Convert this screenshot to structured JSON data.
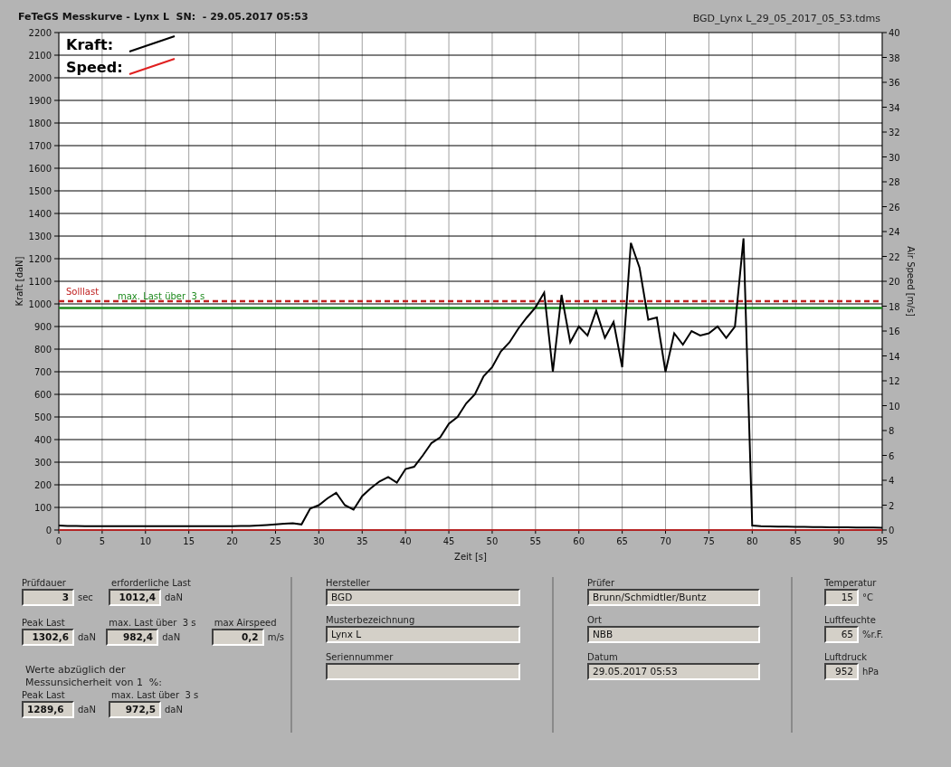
{
  "window": {
    "title": "FeTeGS Messkurve - Lynx L  SN:  - 29.05.2017 05:53",
    "file": "BGD_Lynx L_29_05_2017_05_53.tdms"
  },
  "chart": {
    "chart_data": {
      "type": "line",
      "legend": true,
      "xlabel": "Zeit [s]",
      "ylabel": "Kraft [daN]",
      "y2label": "Air Speed [m/s]",
      "grid": true,
      "xlim": [
        0,
        95
      ],
      "ylim": [
        0,
        2200
      ],
      "y2lim": [
        0,
        40
      ],
      "y2ticks": [
        0,
        2,
        4,
        6,
        8,
        10,
        12,
        14,
        16,
        18,
        20,
        22,
        24,
        26,
        28,
        30,
        32,
        34,
        36,
        38,
        40
      ],
      "xticks": [
        0,
        5,
        10,
        15,
        20,
        25,
        30,
        35,
        40,
        45,
        50,
        55,
        60,
        65,
        70,
        75,
        80,
        85,
        90,
        95
      ],
      "yticks": [
        0,
        100,
        200,
        300,
        400,
        500,
        600,
        700,
        800,
        900,
        1000,
        1100,
        1200,
        1300,
        1400,
        1500,
        1600,
        1700,
        1800,
        1900,
        2000,
        2100,
        2200
      ],
      "x": [
        0,
        1,
        2,
        3,
        4,
        5,
        6,
        7,
        8,
        9,
        10,
        11,
        12,
        13,
        14,
        15,
        16,
        17,
        18,
        19,
        20,
        21,
        22,
        23,
        24,
        25,
        26,
        27,
        28,
        29,
        30,
        31,
        32,
        33,
        34,
        35,
        36,
        37,
        38,
        39,
        40,
        41,
        42,
        43,
        44,
        45,
        46,
        47,
        48,
        49,
        50,
        51,
        52,
        53,
        54,
        55,
        56,
        57,
        58,
        59,
        60,
        61,
        62,
        63,
        64,
        65,
        66,
        67,
        68,
        69,
        70,
        71,
        72,
        73,
        74,
        75,
        76,
        77,
        78,
        79,
        80,
        81,
        82,
        83,
        84,
        85,
        86,
        87,
        88,
        89,
        90,
        91,
        92,
        93,
        94,
        95
      ],
      "series": [
        {
          "name": "Kraft:",
          "color": "#000000",
          "values": [
            20,
            18,
            18,
            17,
            17,
            17,
            17,
            17,
            17,
            17,
            17,
            17,
            17,
            17,
            17,
            17,
            17,
            17,
            17,
            17,
            17,
            18,
            18,
            20,
            22,
            25,
            28,
            30,
            25,
            95,
            110,
            140,
            165,
            110,
            90,
            150,
            185,
            215,
            235,
            210,
            270,
            280,
            330,
            385,
            410,
            470,
            500,
            560,
            600,
            680,
            720,
            790,
            830,
            890,
            940,
            985,
            1050,
            700,
            1040,
            830,
            900,
            860,
            970,
            850,
            920,
            720,
            1270,
            1160,
            930,
            940,
            700,
            870,
            820,
            880,
            860,
            870,
            900,
            850,
            900,
            1290,
            20,
            17,
            16,
            15,
            15,
            14,
            14,
            13,
            13,
            12,
            12,
            12,
            11,
            11,
            11,
            10
          ]
        },
        {
          "name": "Speed:",
          "color": "#e02020",
          "axis": "y2",
          "values": [
            0,
            0,
            0,
            0,
            0,
            0,
            0,
            0,
            0,
            0,
            0,
            0,
            0,
            0,
            0,
            0,
            0,
            0,
            0,
            0,
            0,
            0,
            0,
            0,
            0,
            0,
            0,
            0,
            0,
            0,
            0,
            0,
            0,
            0,
            0,
            0,
            0,
            0,
            0,
            0,
            0,
            0,
            0,
            0,
            0,
            0,
            0,
            0,
            0,
            0,
            0,
            0,
            0,
            0,
            0,
            0,
            0,
            0,
            0,
            0,
            0,
            0,
            0,
            0,
            0,
            0,
            0,
            0,
            0,
            0,
            0,
            0,
            0,
            0,
            0,
            0,
            0,
            0,
            0,
            0,
            0,
            0,
            0,
            0,
            0,
            0,
            0,
            0,
            0,
            0,
            0,
            0,
            0,
            0,
            0,
            0
          ]
        }
      ],
      "ref_lines": [
        {
          "axis": "y",
          "value": 1012.4,
          "label": "Solllast",
          "color": "#c02020"
        },
        {
          "axis": "y",
          "value": 982.4,
          "label": "max. Last über  3 s",
          "color": "#1e8a1e"
        }
      ]
    }
  },
  "results": {
    "rows": [
      [
        {
          "label": "Prüfdauer",
          "value": "3",
          "unit": "sec"
        },
        {
          "label": "erforderliche Last",
          "value": "1012,4",
          "unit": "daN"
        }
      ],
      [
        {
          "label": "Peak Last",
          "value": "1302,6",
          "unit": "daN"
        },
        {
          "label": "max. Last über  3 s",
          "value": "982,4",
          "unit": "daN"
        },
        {
          "label": "max Airspeed",
          "value": "0,2",
          "unit": "m/s"
        }
      ]
    ],
    "note": "Werte abzüglich der\nMessunsicherheit von 1  %:",
    "corrected": [
      {
        "label": "Peak Last",
        "value": "1289,6",
        "unit": "daN"
      },
      {
        "label": "max. Last über  3 s",
        "value": "972,5",
        "unit": "daN"
      }
    ]
  },
  "info_left": [
    {
      "label": "Hersteller",
      "value": "BGD"
    },
    {
      "label": "Musterbezeichnung",
      "value": "Lynx L"
    },
    {
      "label": "Seriennummer"
    }
  ],
  "info_right": [
    {
      "label": "Prüfer",
      "value": "Brunn/Schmidtler/Buntz"
    },
    {
      "label": "Ort",
      "value": "NBB"
    },
    {
      "label": "Datum",
      "value": "29.05.2017 05:53"
    }
  ],
  "conditions": [
    {
      "label": "Temperatur",
      "value": "15",
      "unit": "°C"
    },
    {
      "label": "Luftfeuchte",
      "value": "65",
      "unit": "%r.F."
    },
    {
      "label": "Luftdruck",
      "value": "952",
      "unit": "hPa"
    }
  ]
}
